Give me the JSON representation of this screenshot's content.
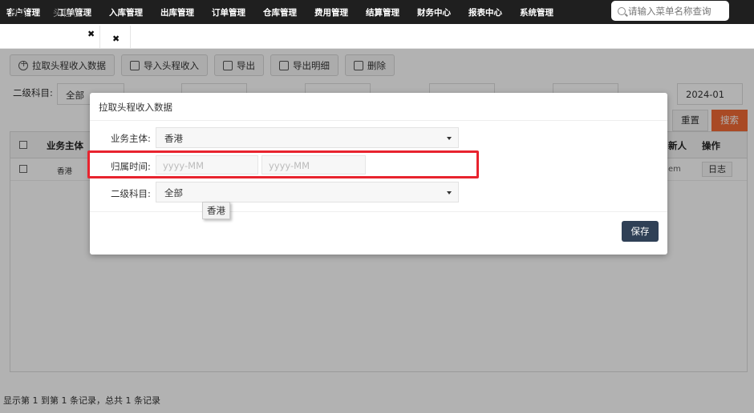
{
  "topnav": {
    "menu": [
      "客户管理",
      "工单管理",
      "入库管理",
      "出库管理",
      "订单管理",
      "仓库管理",
      "费用管理",
      "结算管理",
      "财务中心",
      "报表中心",
      "系统管理"
    ],
    "search_placeholder": "请输入菜单名称查询"
  },
  "tabs": {
    "home": "首页",
    "current": "头程收入",
    "close_glyph": "✖"
  },
  "toolbar": {
    "pull": "拉取头程收入数据",
    "import": "导入头程收入",
    "export": "导出",
    "export_detail": "导出明细",
    "delete": "删除"
  },
  "filters": {
    "subject_label": "二级科目:",
    "subject_value": "全部",
    "end_date_value": "2024-01",
    "reset": "重置",
    "search": "搜索"
  },
  "table": {
    "headers": {
      "entity": "业务主体",
      "updater": "新人",
      "ops": "操作"
    },
    "rows": [
      {
        "entity": "香港",
        "updater": "em",
        "op": "日志"
      }
    ]
  },
  "footer": "显示第 1 到第 1 条记录，总共 1 条记录",
  "modal": {
    "title": "拉取头程收入数据",
    "entity_label": "业务主体:",
    "entity_value": "香港",
    "period_label": "归属时间:",
    "period_start_placeholder": "yyyy-MM",
    "period_end_placeholder": "yyyy-MM",
    "subject_label": "二级科目:",
    "subject_value": "全部",
    "tooltip": "香港",
    "save": "保存"
  },
  "colors": {
    "nav_bg": "#1f1f1f",
    "search_btn": "#f26b36",
    "save_btn": "#2f4056",
    "highlight": "#e8232e"
  }
}
